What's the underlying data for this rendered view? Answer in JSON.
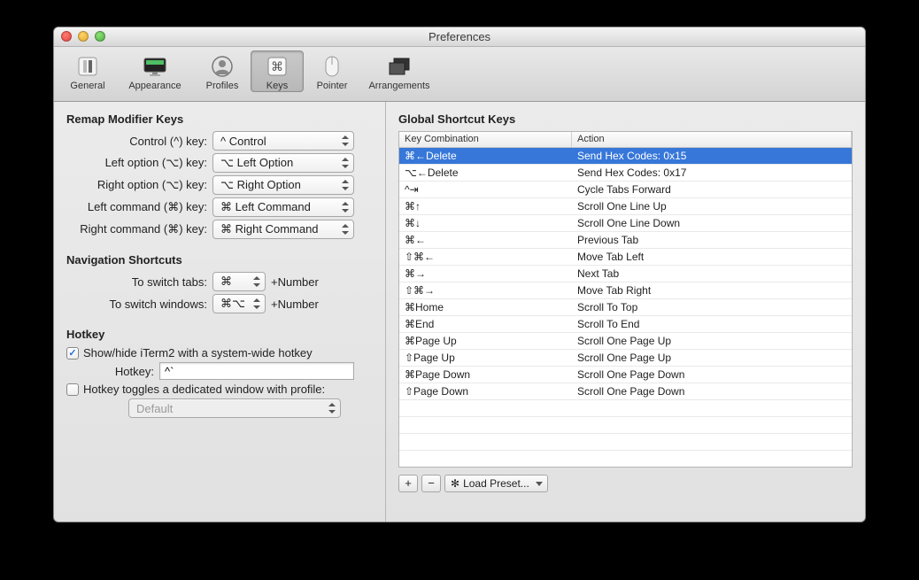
{
  "window_title": "Preferences",
  "toolbar": {
    "items": [
      {
        "label": "General"
      },
      {
        "label": "Appearance"
      },
      {
        "label": "Profiles"
      },
      {
        "label": "Keys"
      },
      {
        "label": "Pointer"
      },
      {
        "label": "Arrangements"
      }
    ],
    "selected_index": 3
  },
  "remap": {
    "title": "Remap Modifier Keys",
    "rows": [
      {
        "label": "Control (^) key:",
        "value": "^ Control"
      },
      {
        "label": "Left option (⌥) key:",
        "value": "⌥ Left Option"
      },
      {
        "label": "Right option (⌥) key:",
        "value": "⌥ Right Option"
      },
      {
        "label": "Left command (⌘) key:",
        "value": "⌘ Left Command"
      },
      {
        "label": "Right command (⌘) key:",
        "value": "⌘ Right Command"
      }
    ]
  },
  "nav": {
    "title": "Navigation Shortcuts",
    "switch_tabs_label": "To switch tabs:",
    "switch_tabs_value": "⌘",
    "switch_windows_label": "To switch windows:",
    "switch_windows_value": "⌘⌥",
    "number_suffix": "+Number"
  },
  "hotkey": {
    "title": "Hotkey",
    "showhide_label": "Show/hide iTerm2 with a system-wide hotkey",
    "showhide_checked": true,
    "hotkey_label": "Hotkey:",
    "hotkey_value": "^`",
    "toggles_label": "Hotkey toggles a dedicated window with profile:",
    "toggles_checked": false,
    "profile_select": "Default"
  },
  "shortcuts": {
    "title": "Global Shortcut Keys",
    "columns": {
      "key": "Key Combination",
      "action": "Action"
    },
    "rows": [
      {
        "key": "⌘←Delete",
        "action": "Send Hex Codes: 0x15",
        "selected": true
      },
      {
        "key": "⌥←Delete",
        "action": "Send Hex Codes: 0x17"
      },
      {
        "key": "^⇥",
        "action": "Cycle Tabs Forward"
      },
      {
        "key": "⌘↑",
        "action": "Scroll One Line Up"
      },
      {
        "key": "⌘↓",
        "action": "Scroll One Line Down"
      },
      {
        "key": "⌘←",
        "action": "Previous Tab"
      },
      {
        "key": "⇧⌘←",
        "action": "Move Tab Left"
      },
      {
        "key": "⌘→",
        "action": "Next Tab"
      },
      {
        "key": "⇧⌘→",
        "action": "Move Tab Right"
      },
      {
        "key": "⌘Home",
        "action": "Scroll To Top"
      },
      {
        "key": "⌘End",
        "action": "Scroll To End"
      },
      {
        "key": "⌘Page Up",
        "action": "Scroll One Page Up"
      },
      {
        "key": "⇧Page Up",
        "action": "Scroll One Page Up"
      },
      {
        "key": "⌘Page Down",
        "action": "Scroll One Page Down"
      },
      {
        "key": "⇧Page Down",
        "action": "Scroll One Page Down"
      }
    ],
    "add_label": "+",
    "remove_label": "−",
    "load_preset_label": "Load Preset..."
  }
}
